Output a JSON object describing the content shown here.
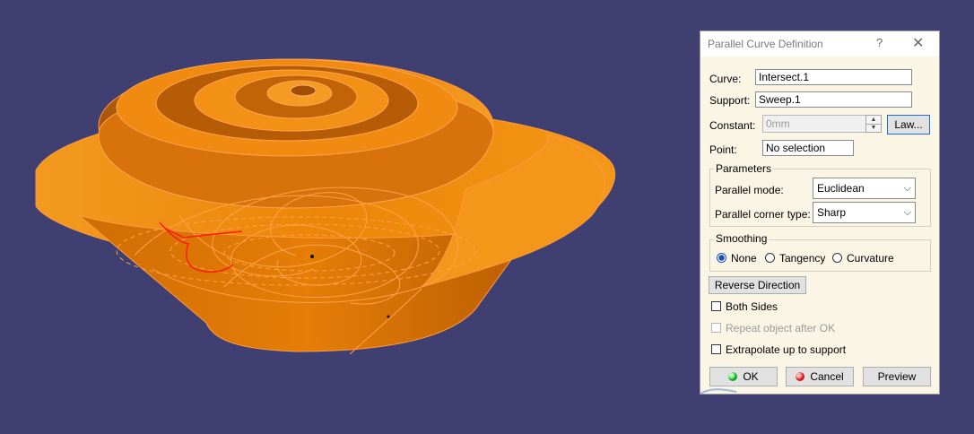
{
  "dialog": {
    "title": "Parallel Curve Definition",
    "help_glyph": "?",
    "close_glyph": "✕",
    "curve_label": "Curve:",
    "curve_value": "Intersect.1",
    "support_label": "Support:",
    "support_value": "Sweep.1",
    "constant_label": "Constant:",
    "constant_value": "0mm",
    "law_button": "Law...",
    "point_label": "Point:",
    "point_value": "No selection",
    "parameters": {
      "title": "Parameters",
      "parallel_mode_label": "Parallel mode:",
      "parallel_mode_value": "Euclidean",
      "corner_type_label": "Parallel corner type:",
      "corner_type_value": "Sharp"
    },
    "smoothing": {
      "title": "Smoothing",
      "options": [
        "None",
        "Tangency",
        "Curvature"
      ],
      "selected": "None"
    },
    "reverse_direction_button": "Reverse Direction",
    "both_sides_label": "Both Sides",
    "repeat_object_label": "Repeat object after OK",
    "extrapolate_label": "Extrapolate up to support",
    "ok_button": "OK",
    "cancel_button": "Cancel",
    "preview_button": "Preview"
  },
  "icons": {
    "help": "help-icon",
    "close": "close-icon",
    "ok": "ok-green-dot-icon",
    "cancel": "cancel-red-dot-icon",
    "combo": "chevron-down-icon"
  },
  "colors": {
    "viewport_bg": "#3f3f72",
    "surface_orange": "#f08a10",
    "surface_dark": "#c86a05",
    "curve_lines": "#ff9a40",
    "selected_curve": "#ff1a00",
    "dialog_bg": "#fbf5e6"
  }
}
